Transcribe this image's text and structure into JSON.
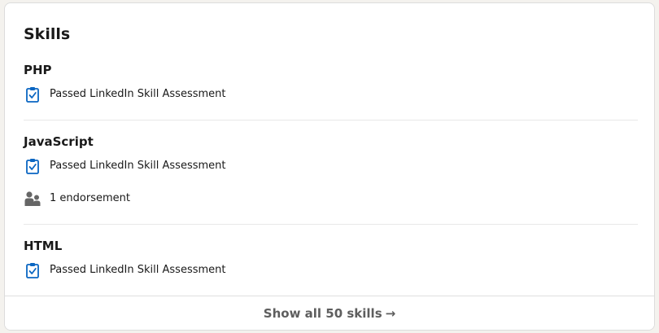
{
  "section": {
    "title": "Skills"
  },
  "skills": [
    {
      "name": "PHP",
      "assessment": "Passed LinkedIn Skill Assessment"
    },
    {
      "name": "JavaScript",
      "assessment": "Passed LinkedIn Skill Assessment",
      "endorsements": "1 endorsement"
    },
    {
      "name": "HTML",
      "assessment": "Passed LinkedIn Skill Assessment"
    }
  ],
  "footer": {
    "label": "Show all 50 skills",
    "arrow": "→"
  },
  "icons": {
    "assessment": "clipboard-check-icon",
    "endorsement": "people-icon"
  },
  "colors": {
    "assessment_icon": "#0a66c2",
    "endorsement_icon": "#666666"
  }
}
